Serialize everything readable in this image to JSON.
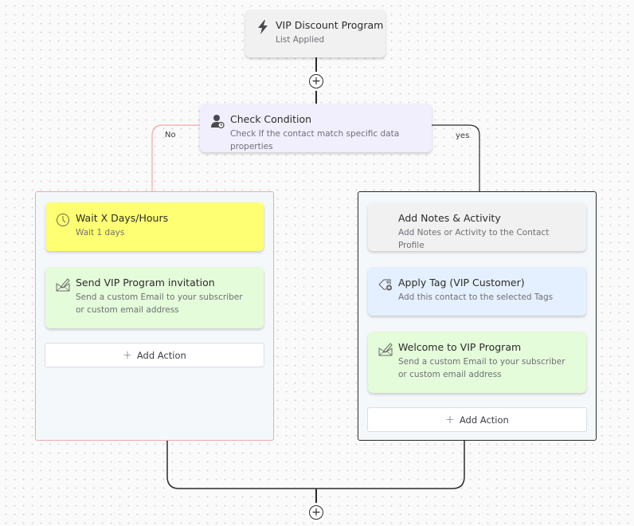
{
  "trigger": {
    "icon": "bolt-icon",
    "title": "VIP Discount Program",
    "subtitle": "List Applied"
  },
  "condition": {
    "icon": "user-check-icon",
    "title": "Check Condition",
    "subtitle": "Check If the contact match specific data properties"
  },
  "branches": {
    "no": {
      "label": "No",
      "color": "#f2a9aa",
      "actions": [
        {
          "icon": "clock-icon",
          "title": "Wait X Days/Hours",
          "subtitle": "Wait 1 days",
          "color": "#ffff73"
        },
        {
          "icon": "email-edit-icon",
          "title": "Send VIP Program invitation",
          "subtitle": "Send a custom Email to your subscriber or custom email address",
          "color": "#e4fcd9"
        }
      ],
      "add_action_label": "Add Action"
    },
    "yes": {
      "label": "yes",
      "color": "#2b2b2b",
      "actions": [
        {
          "icon": "",
          "title": "Add Notes & Activity",
          "subtitle": "Add Notes or Activity to the Contact Profile",
          "color": "#f1f1f1"
        },
        {
          "icon": "tag-add-icon",
          "title": "Apply Tag (VIP Customer)",
          "subtitle": "Add this contact to the selected Tags",
          "color": "#e4f0ff"
        },
        {
          "icon": "email-edit-icon",
          "title": "Welcome to VIP Program",
          "subtitle": "Send a custom Email to your subscriber or custom email address",
          "color": "#e4fcd9"
        }
      ],
      "add_action_label": "Add Action"
    }
  },
  "add_step_symbol": "+"
}
